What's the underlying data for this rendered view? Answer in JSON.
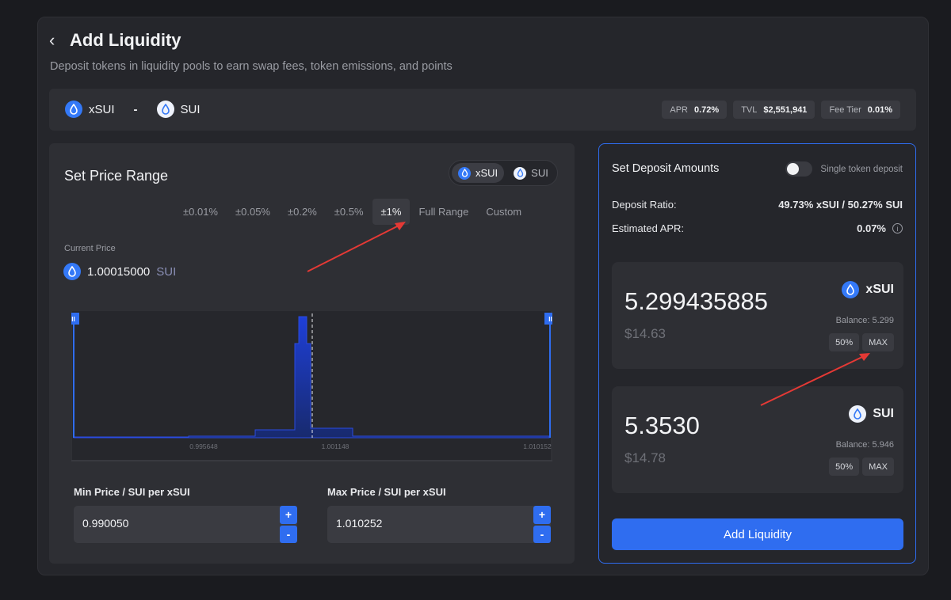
{
  "header": {
    "title": "Add Liquidity",
    "subtitle": "Deposit tokens in liquidity pools to earn swap fees, token emissions, and points"
  },
  "pair": {
    "token_a": "xSUI",
    "separator": "-",
    "token_b": "SUI",
    "stats": [
      {
        "key": "APR",
        "value": "0.72%"
      },
      {
        "key": "TVL",
        "value": "$2,551,941"
      },
      {
        "key": "Fee Tier",
        "value": "0.01%"
      }
    ]
  },
  "price_range": {
    "title": "Set Price Range",
    "toggle": [
      "xSUI",
      "SUI"
    ],
    "ranges": [
      "±0.01%",
      "±0.05%",
      "±0.2%",
      "±0.5%",
      "±1%",
      "Full Range",
      "Custom"
    ],
    "active_range": "±1%",
    "current_price_label": "Current Price",
    "current_price": "1.00015000",
    "current_price_unit": "SUI",
    "chart_ticks": [
      "0.995648",
      "1.001148",
      "1.010152"
    ],
    "min_label": "Min Price / SUI per xSUI",
    "min_value": "0.990050",
    "max_label": "Max Price / SUI per xSUI",
    "max_value": "1.010252",
    "plus": "+",
    "minus": "-"
  },
  "deposit": {
    "title": "Set Deposit Amounts",
    "single_label": "Single token deposit",
    "ratio_label": "Deposit Ratio:",
    "ratio_value": "49.73% xSUI / 50.27% SUI",
    "apr_label": "Estimated APR:",
    "apr_value": "0.07%",
    "info": "i",
    "tokens": [
      {
        "amount": "5.299435885",
        "usd": "$14.63",
        "symbol": "xSUI",
        "balance_label": "Balance:",
        "balance": "5.299",
        "half": "50%",
        "max": "MAX"
      },
      {
        "amount": "5.3530",
        "usd": "$14.78",
        "symbol": "SUI",
        "balance_label": "Balance:",
        "balance": "5.946",
        "half": "50%",
        "max": "MAX"
      }
    ],
    "submit": "Add Liquidity"
  },
  "colors": {
    "accent": "#2f6df0",
    "annotation": "#e53935"
  }
}
